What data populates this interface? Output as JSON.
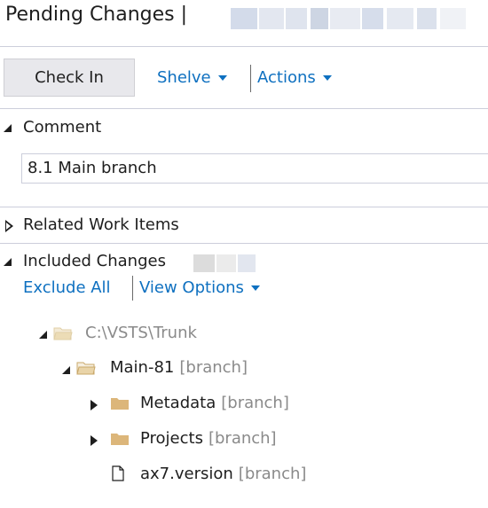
{
  "header": {
    "title": "Pending Changes |"
  },
  "toolbar": {
    "check_in_label": "Check In",
    "shelve_label": "Shelve",
    "actions_label": "Actions"
  },
  "comment_section": {
    "label": "Comment",
    "value": "8.1 Main branch"
  },
  "related_work_items": {
    "label": "Related Work Items"
  },
  "included_changes": {
    "label": "Included Changes",
    "exclude_all_label": "Exclude All",
    "view_options_label": "View Options"
  },
  "tree": {
    "root": {
      "label": "C:\\VSTS\\Trunk"
    },
    "branch": {
      "label": "Main-81",
      "tag": "[branch]"
    },
    "children": [
      {
        "label": "Metadata",
        "tag": "[branch]",
        "type": "folder"
      },
      {
        "label": "Projects",
        "tag": "[branch]",
        "type": "folder"
      },
      {
        "label": "ax7.version",
        "tag": "[branch]",
        "type": "file"
      }
    ]
  },
  "colors": {
    "link": "#0e70c0",
    "folder": "#dcb67a",
    "folder_muted": "#e6d3a8",
    "separator": "#cccedb",
    "button_bg": "#e8e8ec"
  }
}
